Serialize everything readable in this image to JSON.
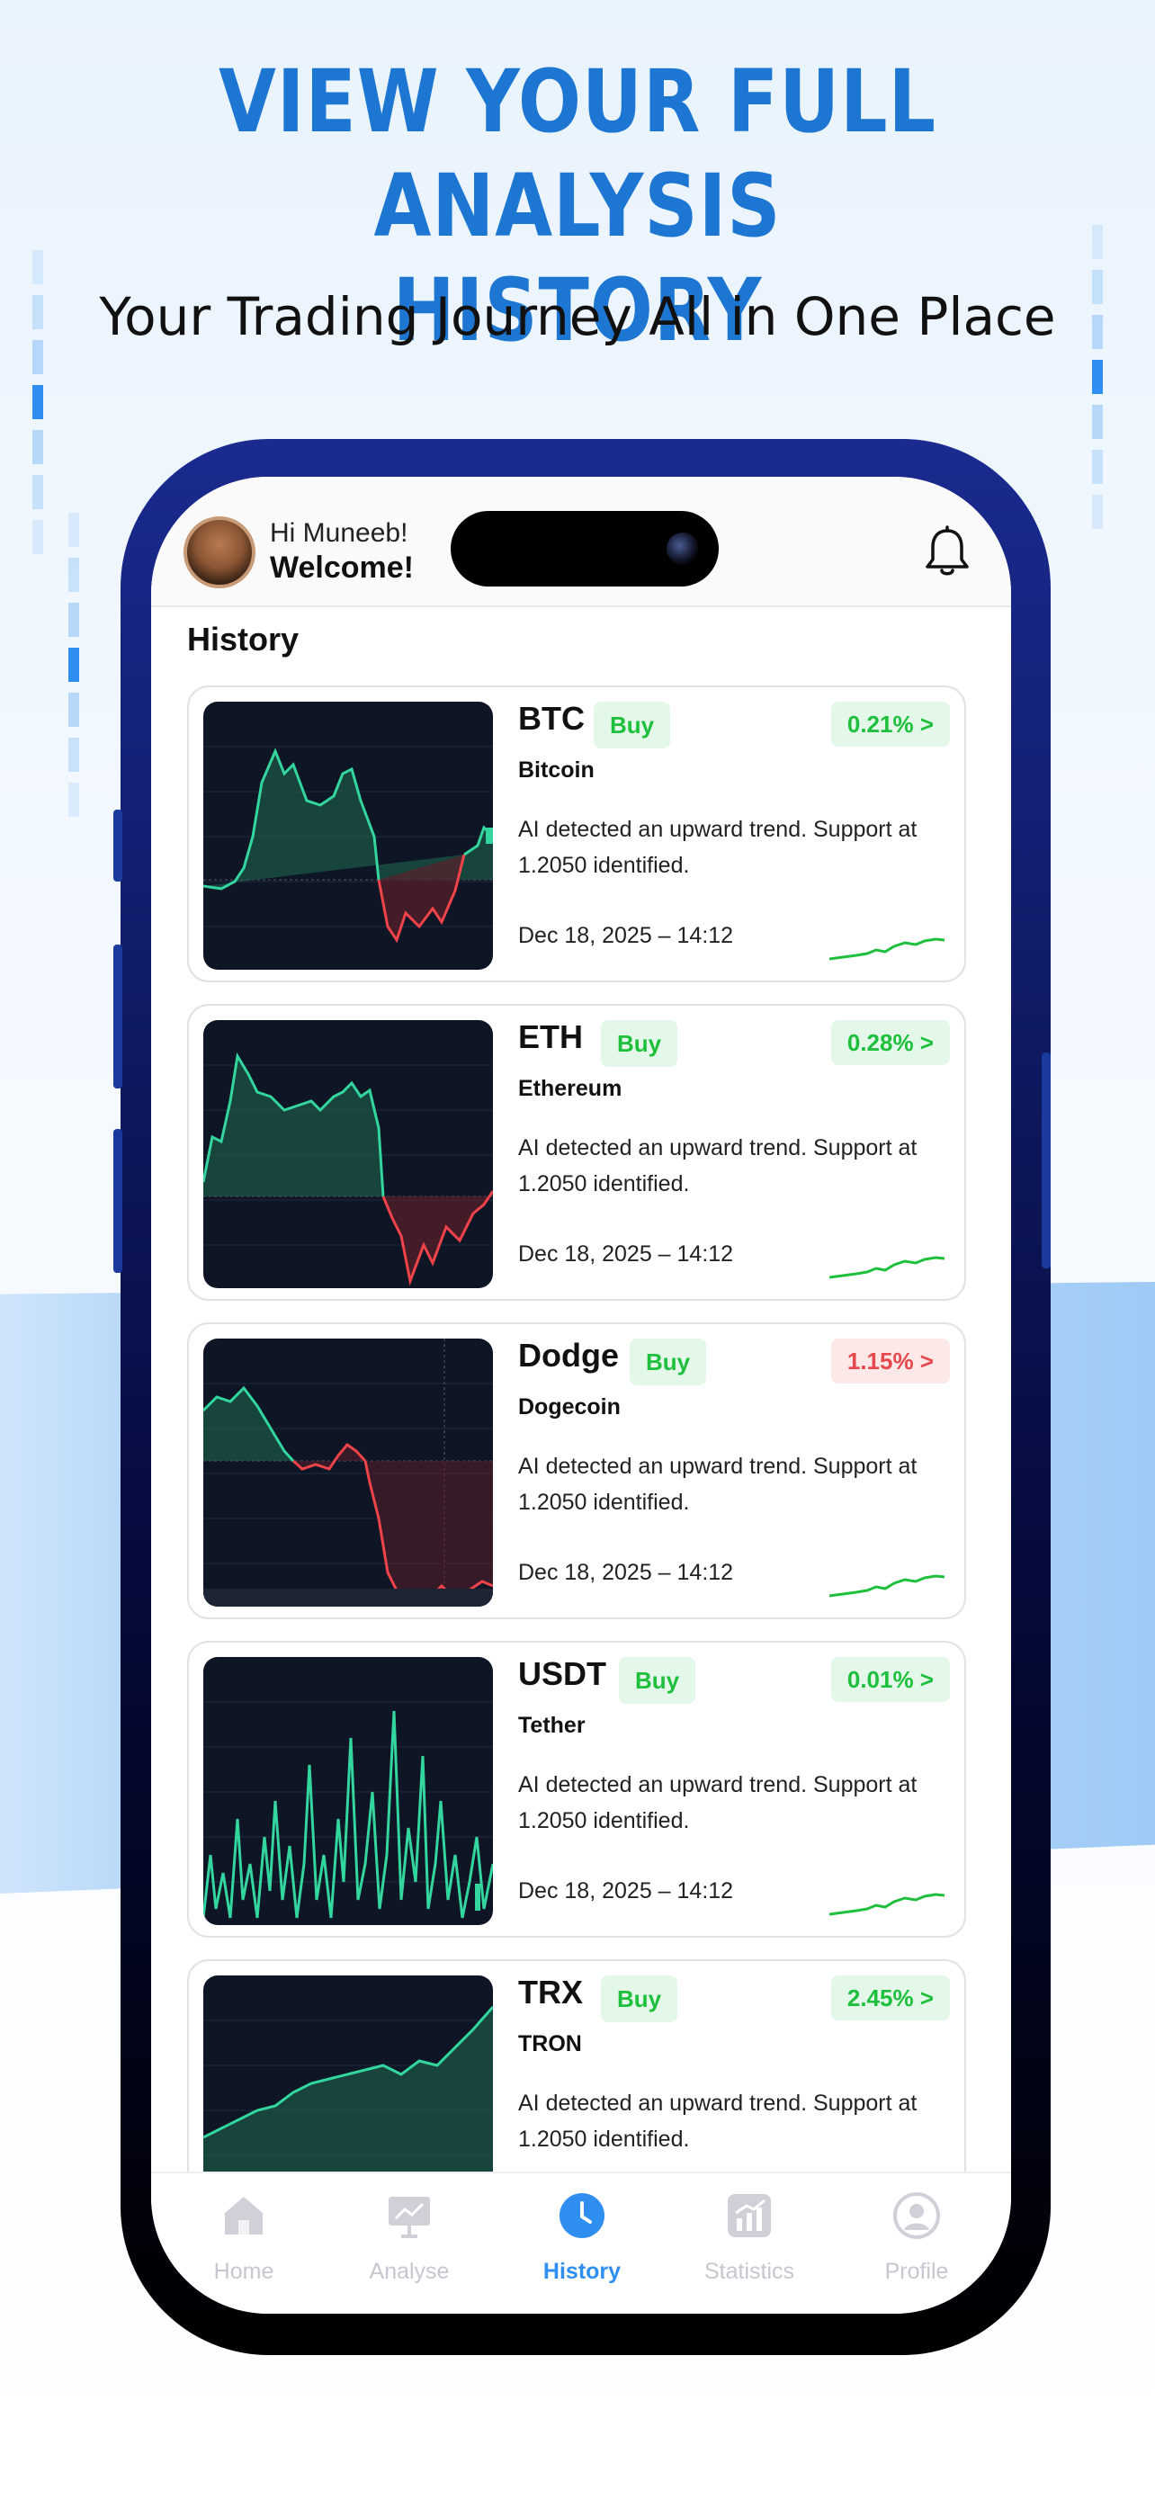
{
  "hero": {
    "title_line1": "VIEW YOUR FULL ANALYSIS",
    "title_line2": "HISTORY",
    "subtitle": "Your Trading Journey All in One Place"
  },
  "header": {
    "greeting": "Hi Muneeb!",
    "welcome": "Welcome!"
  },
  "section_title": "History",
  "cards": [
    {
      "symbol": "BTC",
      "buy_label": "Buy",
      "name": "Bitcoin",
      "change": "0.21% >",
      "direction": "up",
      "description": "AI detected an upward trend. Support at 1.2050 identified.",
      "date": "Dec 18, 2025 – 14:12"
    },
    {
      "symbol": "ETH",
      "buy_label": "Buy",
      "name": "Ethereum",
      "change": "0.28% >",
      "direction": "up",
      "description": "AI detected an upward trend. Support at 1.2050 identified.",
      "date": "Dec 18, 2025 – 14:12"
    },
    {
      "symbol": "Dodge",
      "buy_label": "Buy",
      "name": "Dogecoin",
      "change": "1.15% >",
      "direction": "down",
      "description": "AI detected an upward trend. Support at 1.2050 identified.",
      "date": "Dec 18, 2025 – 14:12"
    },
    {
      "symbol": "USDT",
      "buy_label": "Buy",
      "name": "Tether",
      "change": "0.01% >",
      "direction": "up",
      "description": "AI detected an upward trend. Support at 1.2050 identified.",
      "date": "Dec 18, 2025 – 14:12"
    },
    {
      "symbol": "TRX",
      "buy_label": "Buy",
      "name": "TRON",
      "change": "2.45% >",
      "direction": "up",
      "description": "AI detected an upward trend. Support at 1.2050 identified.",
      "date": ""
    }
  ],
  "tabs": [
    {
      "label": "Home",
      "icon": "home-icon"
    },
    {
      "label": "Analyse",
      "icon": "presentation-chart-icon"
    },
    {
      "label": "History",
      "icon": "clock-icon",
      "active": true
    },
    {
      "label": "Statistics",
      "icon": "bar-chart-icon"
    },
    {
      "label": "Profile",
      "icon": "user-icon"
    }
  ],
  "colors": {
    "accent": "#1d77d2",
    "positive": "#1fbf3e",
    "negative": "#e5484d",
    "active_tab": "#2f8ff0"
  }
}
